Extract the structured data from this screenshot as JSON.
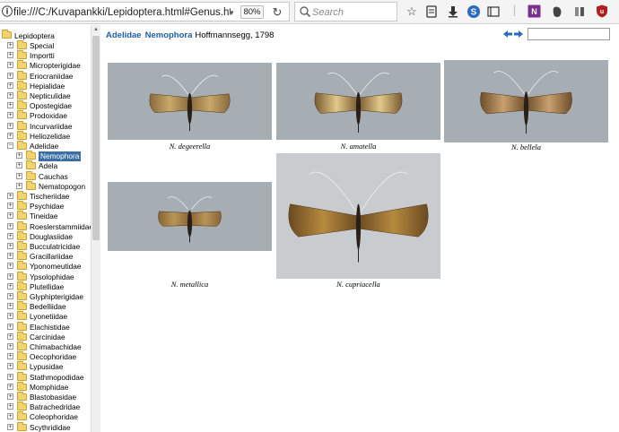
{
  "browser": {
    "url": "file:///C:/Kuvapankki/Lepidoptera.html#Genus.html?ge",
    "zoom": "80%",
    "search_placeholder": "Search",
    "icons": [
      "info-icon",
      "dropdown-arrow-icon",
      "reload-icon",
      "search-icon",
      "bookmark-star-icon",
      "reading-list-icon",
      "download-icon",
      "s-extension-icon",
      "menu-icon",
      "onenote-icon",
      "evernote-icon",
      "pocket-icon",
      "ublock-icon"
    ]
  },
  "tree": {
    "root": "Lepidoptera",
    "items": [
      {
        "label": "Special",
        "expander": "+",
        "level": 1
      },
      {
        "label": "Importti",
        "expander": "+",
        "level": 1
      },
      {
        "label": "Micropterigidae",
        "expander": "+",
        "level": 1
      },
      {
        "label": "Eriocraniidae",
        "expander": "+",
        "level": 1
      },
      {
        "label": "Hepialidae",
        "expander": "+",
        "level": 1
      },
      {
        "label": "Nepticulidae",
        "expander": "+",
        "level": 1
      },
      {
        "label": "Opostegidae",
        "expander": "+",
        "level": 1
      },
      {
        "label": "Prodoxidae",
        "expander": "+",
        "level": 1
      },
      {
        "label": "Incurvariidae",
        "expander": "+",
        "level": 1
      },
      {
        "label": "Heliozelidae",
        "expander": "+",
        "level": 1
      },
      {
        "label": "Adelidae",
        "expander": "−",
        "level": 1
      },
      {
        "label": "Nemophora",
        "expander": "+",
        "level": 2,
        "selected": true
      },
      {
        "label": "Adela",
        "expander": "+",
        "level": 2
      },
      {
        "label": "Cauchas",
        "expander": "+",
        "level": 2
      },
      {
        "label": "Nematopogon",
        "expander": "+",
        "level": 2
      },
      {
        "label": "Tischeriidae",
        "expander": "+",
        "level": 1
      },
      {
        "label": "Psychidae",
        "expander": "+",
        "level": 1
      },
      {
        "label": "Tineidae",
        "expander": "+",
        "level": 1
      },
      {
        "label": "Roeslerstammiidae",
        "expander": "+",
        "level": 1
      },
      {
        "label": "Douglasiidae",
        "expander": "+",
        "level": 1
      },
      {
        "label": "Bucculatricidae",
        "expander": "+",
        "level": 1
      },
      {
        "label": "Gracillariidae",
        "expander": "+",
        "level": 1
      },
      {
        "label": "Yponomeutidae",
        "expander": "+",
        "level": 1
      },
      {
        "label": "Ypsolophidae",
        "expander": "+",
        "level": 1
      },
      {
        "label": "Plutellidae",
        "expander": "+",
        "level": 1
      },
      {
        "label": "Glyphipterigidae",
        "expander": "+",
        "level": 1
      },
      {
        "label": "Bedelliidae",
        "expander": "+",
        "level": 1
      },
      {
        "label": "Lyonetiidae",
        "expander": "+",
        "level": 1
      },
      {
        "label": "Elachistidae",
        "expander": "+",
        "level": 1
      },
      {
        "label": "Carcinidae",
        "expander": "+",
        "level": 1
      },
      {
        "label": "Chimabachidae",
        "expander": "+",
        "level": 1
      },
      {
        "label": "Oecophoridae",
        "expander": "+",
        "level": 1
      },
      {
        "label": "Lypusidae",
        "expander": "+",
        "level": 1
      },
      {
        "label": "Stathmopodidae",
        "expander": "+",
        "level": 1
      },
      {
        "label": "Momphidae",
        "expander": "+",
        "level": 1
      },
      {
        "label": "Blastobasidae",
        "expander": "+",
        "level": 1
      },
      {
        "label": "Batrachedridae",
        "expander": "+",
        "level": 1
      },
      {
        "label": "Coleophoridae",
        "expander": "+",
        "level": 1
      },
      {
        "label": "Scythrididae",
        "expander": "+",
        "level": 1
      }
    ]
  },
  "main": {
    "family": "Adelidae",
    "genus": "Nemophora",
    "author": "Hoffmannsegg, 1798",
    "nav_icons": [
      "back-arrow-icon",
      "forward-arrow-icon"
    ],
    "specimens": [
      {
        "caption": "N. degeerella"
      },
      {
        "caption": "N. amatella"
      },
      {
        "caption": "N. bellela"
      },
      {
        "caption": "N. metallica"
      },
      {
        "caption": "N. cupriacella"
      }
    ]
  },
  "colors": {
    "link_blue": "#1f5fa8",
    "selection": "#3a6ea5",
    "folder": "#f3d36b",
    "photo_bg": "#a7aeb3"
  }
}
